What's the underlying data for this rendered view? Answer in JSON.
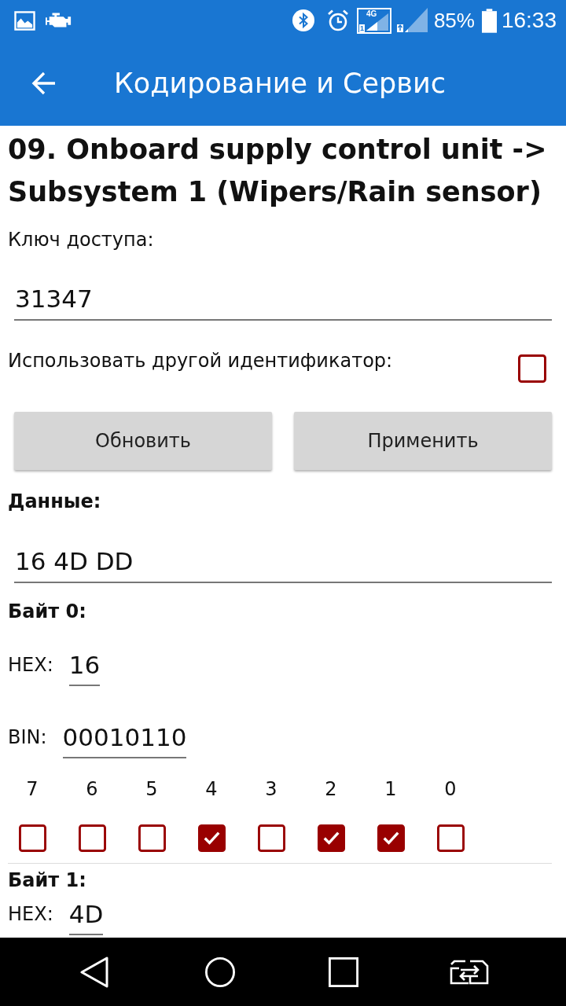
{
  "status_bar": {
    "network_type": "4G",
    "sim_slot": "1",
    "battery": "85%",
    "time": "16:33"
  },
  "app_bar": {
    "title": "Кодирование и Сервис"
  },
  "heading": "09. Onboard supply control unit -> Subsystem 1 (Wipers/Rain sensor)",
  "access_key": {
    "label": "Ключ доступа:",
    "value": "31347"
  },
  "alt_id": {
    "label": "Использовать другой идентификатор:",
    "checked": false
  },
  "buttons": [
    "Обновить",
    "Применить"
  ],
  "data": {
    "label": "Данные:",
    "value": "16 4D DD"
  },
  "bytes": [
    {
      "title": "Байт 0:",
      "hex_label": "HEX:",
      "hex": "16",
      "bin_label": "BIN:",
      "bin": "00010110",
      "bits": [
        {
          "label": "7",
          "checked": false
        },
        {
          "label": "6",
          "checked": false
        },
        {
          "label": "5",
          "checked": false
        },
        {
          "label": "4",
          "checked": true
        },
        {
          "label": "3",
          "checked": false
        },
        {
          "label": "2",
          "checked": true
        },
        {
          "label": "1",
          "checked": true
        },
        {
          "label": "0",
          "checked": false
        }
      ]
    },
    {
      "title": "Байт 1:",
      "hex_label": "HEX:",
      "hex": "4D"
    }
  ]
}
